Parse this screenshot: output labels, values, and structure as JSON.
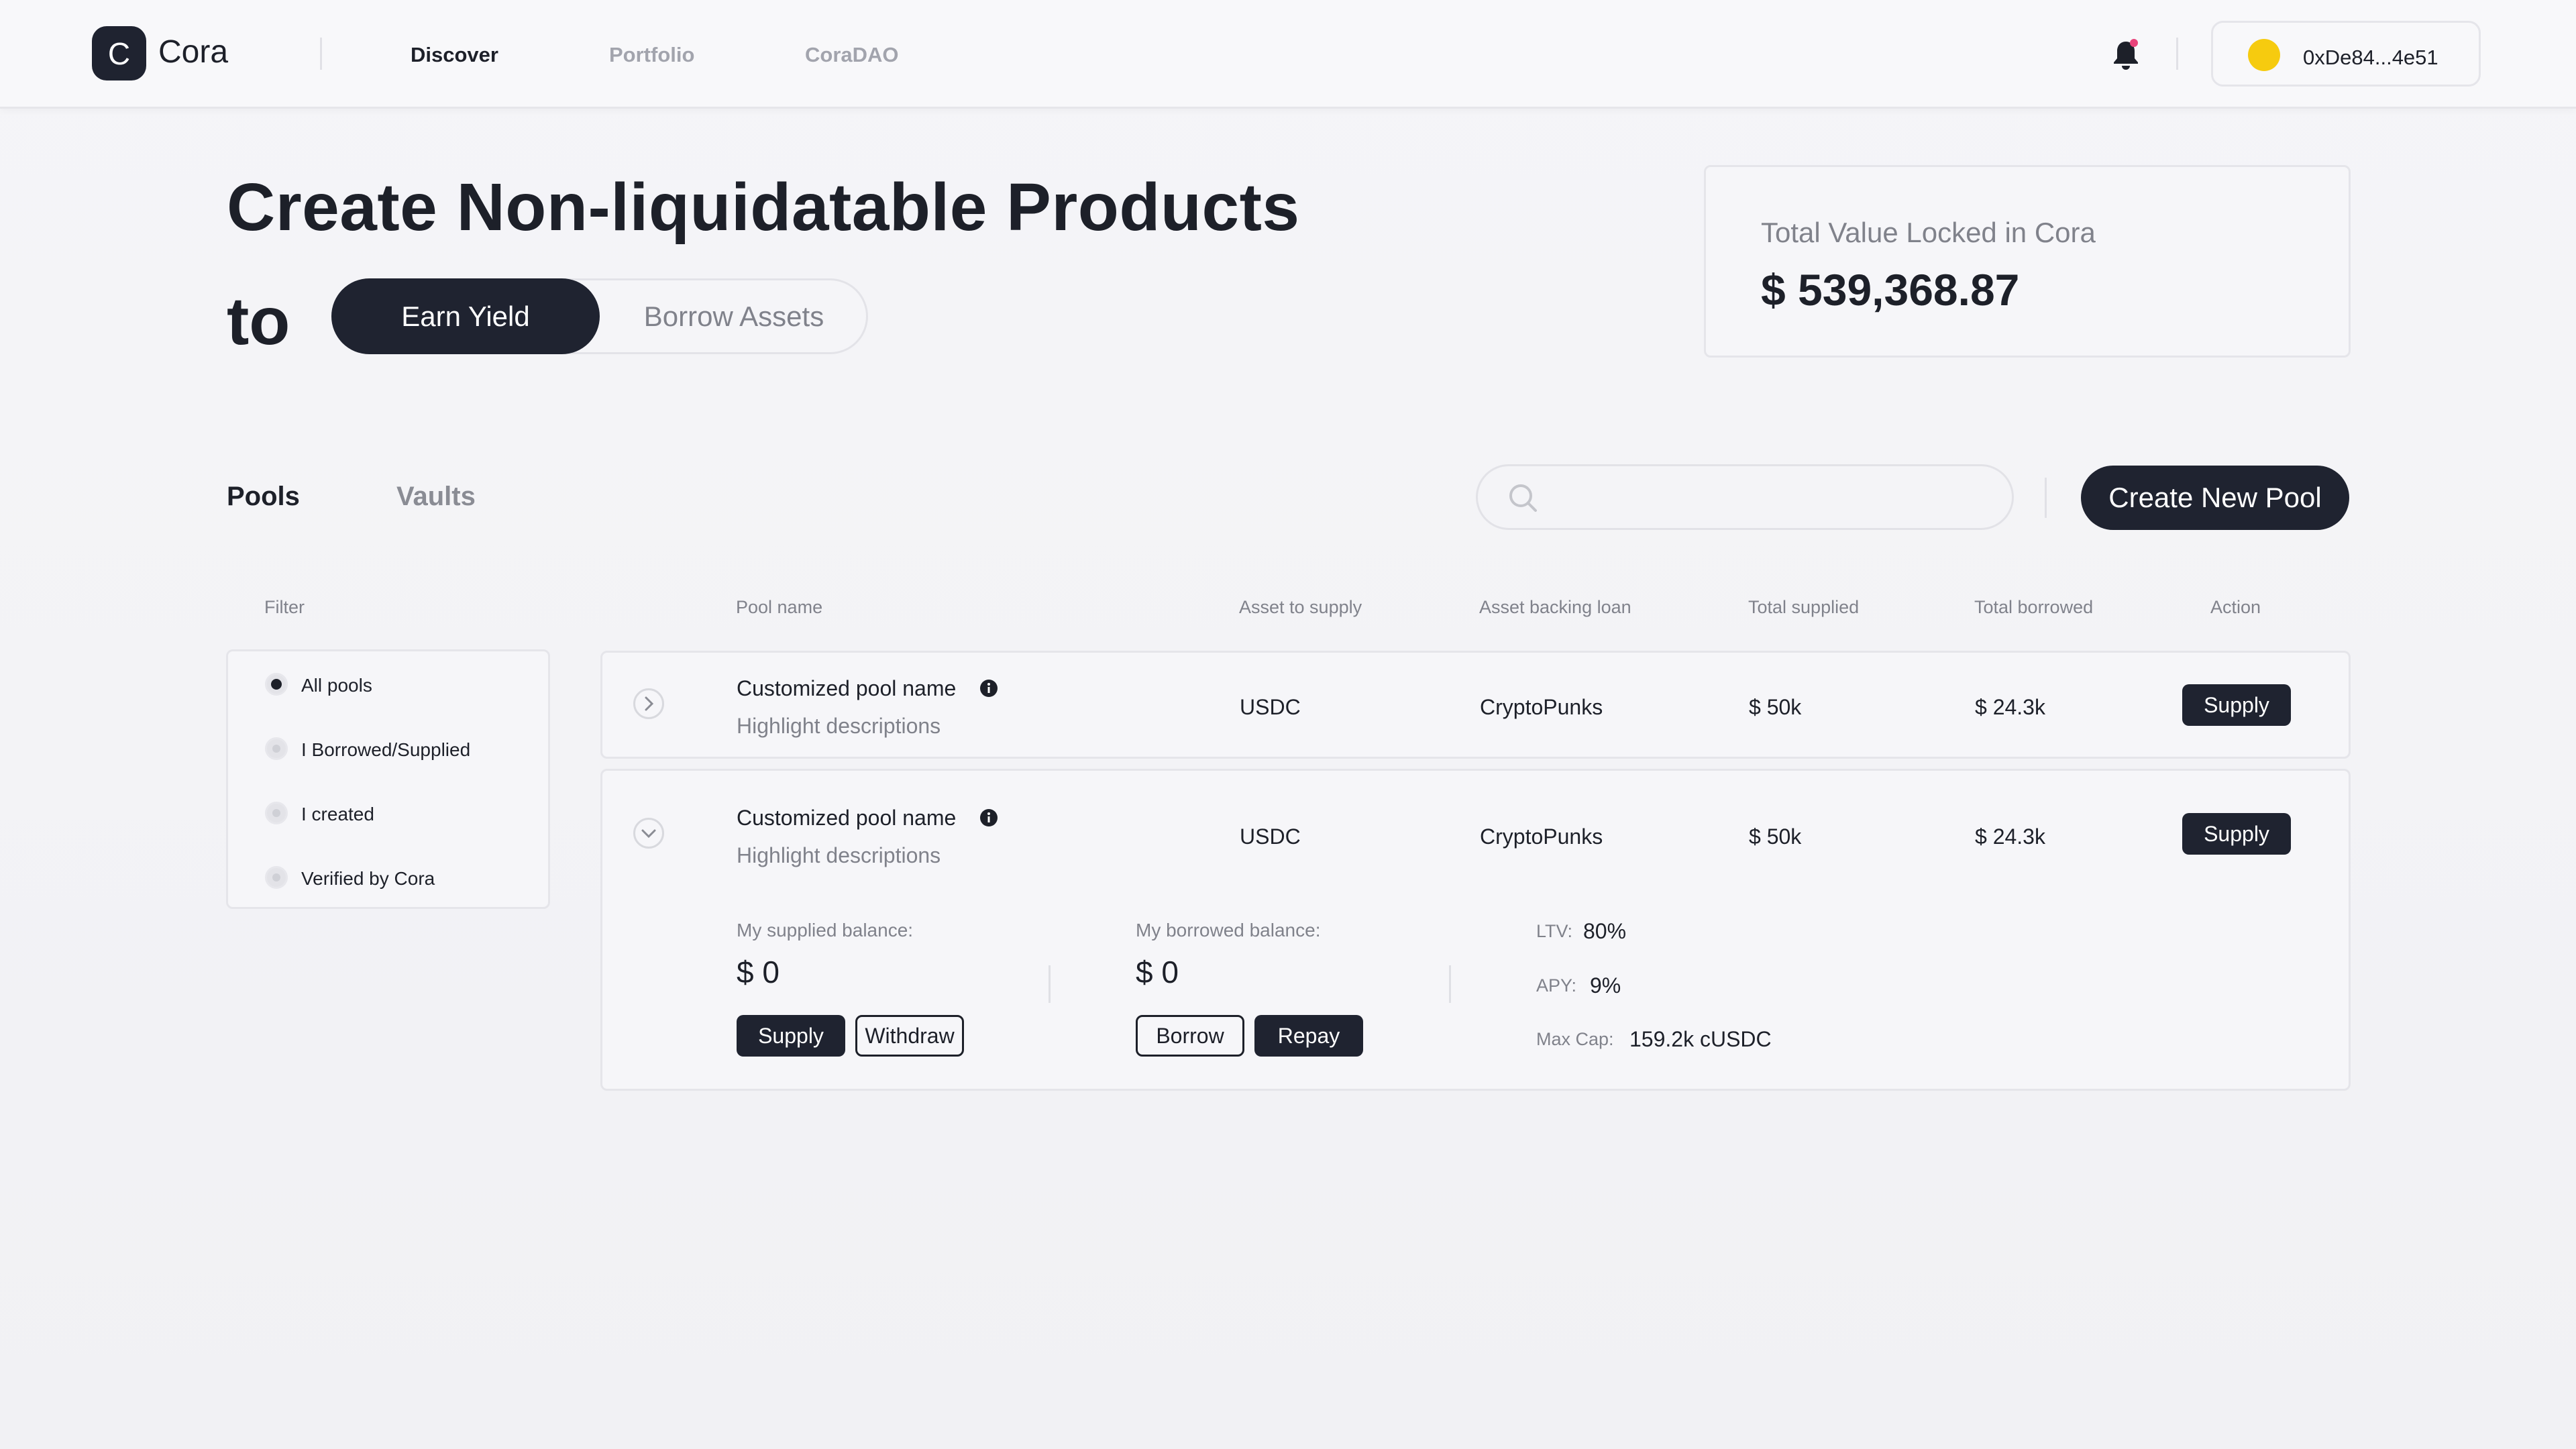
{
  "app": {
    "logo_letter": "C",
    "name": "Cora"
  },
  "nav": {
    "items": [
      {
        "label": "Discover"
      },
      {
        "label": "Portfolio"
      },
      {
        "label": "CoraDAO"
      }
    ],
    "active": "Discover"
  },
  "wallet": {
    "address": "0xDe84...4e51",
    "dot_color": "#f6cb0f"
  },
  "hero": {
    "title": "Create Non-liquidatable Products",
    "to": "to",
    "toggle_on": "Earn Yield",
    "toggle_off": "Borrow Assets"
  },
  "tvl": {
    "label": "Total Value Locked in Cora",
    "value": "$ 539,368.87"
  },
  "tabs": {
    "items": [
      {
        "label": "Pools"
      },
      {
        "label": "Vaults"
      }
    ],
    "active": "Pools"
  },
  "search": {
    "placeholder": "",
    "value": ""
  },
  "create_button": "Create New Pool",
  "filter": {
    "heading": "Filter",
    "options": [
      {
        "label": "All pools",
        "checked": true
      },
      {
        "label": "I Borrowed/Supplied",
        "checked": false
      },
      {
        "label": "I created",
        "checked": false
      },
      {
        "label": "Verified by Cora",
        "checked": false
      }
    ]
  },
  "table": {
    "columns": [
      "Pool name",
      "Asset to supply",
      "Asset backing loan",
      "Total supplied",
      "Total borrowed",
      "Action"
    ],
    "rows": [
      {
        "name": "Customized pool name",
        "description": "Highlight descriptions",
        "asset_supply": "USDC",
        "asset_backing": "CryptoPunks",
        "total_supplied": "$ 50k",
        "total_borrowed": "$ 24.3k",
        "action": "Supply",
        "expanded": false
      },
      {
        "name": "Customized pool name",
        "description": "Highlight descriptions",
        "asset_supply": "USDC",
        "asset_backing": "CryptoPunks",
        "total_supplied": "$ 50k",
        "total_borrowed": "$ 24.3k",
        "action": "Supply",
        "expanded": true,
        "details": {
          "supplied_label": "My supplied balance:",
          "supplied_value": "$ 0",
          "supply_btn": "Supply",
          "withdraw_btn": "Withdraw",
          "borrowed_label": "My borrowed balance:",
          "borrowed_value": "$ 0",
          "borrow_btn": "Borrow",
          "repay_btn": "Repay",
          "ltv_label": "LTV:",
          "ltv_value": "80%",
          "apy_label": "APY:",
          "apy_value": "9%",
          "maxcap_label": "Max Cap:",
          "maxcap_value": "159.2k cUSDC"
        }
      }
    ]
  },
  "colors": {
    "accent_dark": "#1f2330",
    "muted_text": "#80828b",
    "notification_dot": "#e8437a"
  }
}
